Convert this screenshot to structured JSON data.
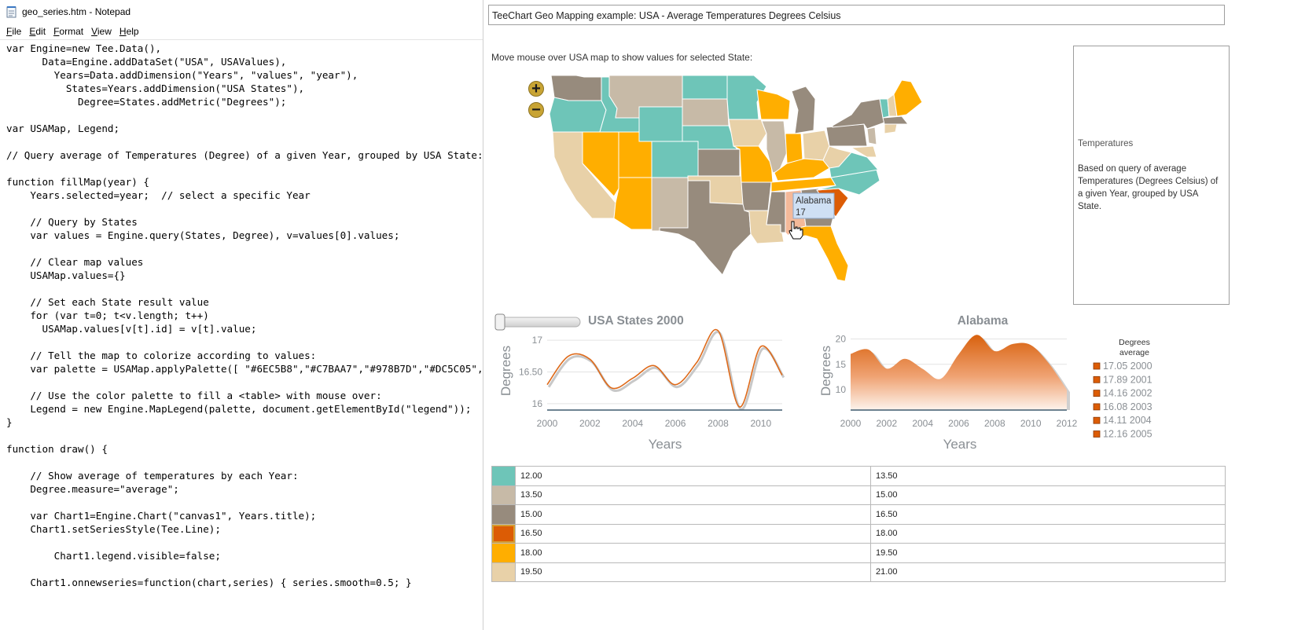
{
  "notepad": {
    "title": "geo_series.htm - Notepad",
    "menu": [
      "File",
      "Edit",
      "Format",
      "View",
      "Help"
    ],
    "code": "var Engine=new Tee.Data(),\n      Data=Engine.addDataSet(\"USA\", USAValues),\n        Years=Data.addDimension(\"Years\", \"values\", \"year\"),\n          States=Years.addDimension(\"USA States\"),\n            Degree=States.addMetric(\"Degrees\");\n\nvar USAMap, Legend;\n\n// Query average of Temperatures (Degree) of a given Year, grouped by USA State:\n\nfunction fillMap(year) {\n    Years.selected=year;  // select a specific Year\n\n    // Query by States\n    var values = Engine.query(States, Degree), v=values[0].values;\n\n    // Clear map values\n    USAMap.values={}\n\n    // Set each State result value\n    for (var t=0; t<v.length; t++)\n      USAMap.values[v[t].id] = v[t].value;\n\n    // Tell the map to colorize according to values:\n    var palette = USAMap.applyPalette([ \"#6EC5B8\",\"#C7BAA7\",\"#978B7D\",\"#DC5C05\",\"\n\n    // Use the color palette to fill a <table> with mouse over:\n    Legend = new Engine.MapLegend(palette, document.getElementById(\"legend\"));\n}\n\nfunction draw() {\n\n    // Show average of temperatures by each Year:\n    Degree.measure=\"average\";\n\n    var Chart1=Engine.Chart(\"canvas1\", Years.title);\n    Chart1.setSeriesStyle(Tee.Line);\n\n        Chart1.legend.visible=false;\n\n    Chart1.onnewseries=function(chart,series) { series.smooth=0.5; }"
  },
  "page": {
    "title": "TeeChart Geo Mapping example: USA - Average Temperatures Degrees Celsius",
    "instructions": "Move mouse over USA map to show values for selected State:",
    "zoom_in": "+",
    "zoom_out": "−",
    "tooltip": {
      "state": "Alabama",
      "value": "17"
    },
    "legend_panel": {
      "title": "Temperatures",
      "description": "Based on query of average Temperatures (Degrees Celsius) of a given Year, grouped by USA State."
    },
    "palette": [
      "#6EC5B8",
      "#C7BAA7",
      "#978B7D",
      "#DC5C05",
      "#FFAE00",
      "#E8D1A8"
    ],
    "icons": {
      "zoom_in": "plus-icon",
      "zoom_out": "minus-icon",
      "cursor": "hand-cursor-icon",
      "file": "notepad-icon"
    }
  },
  "value_table": [
    {
      "color": "#6EC5B8",
      "from": "12.00",
      "to": "13.50",
      "selected": false
    },
    {
      "color": "#C7BAA7",
      "from": "13.50",
      "to": "15.00",
      "selected": false
    },
    {
      "color": "#978B7D",
      "from": "15.00",
      "to": "16.50",
      "selected": false
    },
    {
      "color": "#DC5C05",
      "from": "16.50",
      "to": "18.00",
      "selected": true
    },
    {
      "color": "#FFAE00",
      "from": "18.00",
      "to": "19.50",
      "selected": false
    },
    {
      "color": "#E8D1A8",
      "from": "19.50",
      "to": "21.00",
      "selected": false
    }
  ],
  "chart_data": [
    {
      "type": "line",
      "title": "USA States 2000",
      "xlabel": "Years",
      "ylabel": "Degrees",
      "x": [
        2000,
        2001,
        2002,
        2003,
        2004,
        2005,
        2006,
        2007,
        2008,
        2009,
        2010,
        2011
      ],
      "series": [
        {
          "values": [
            16.3,
            16.75,
            16.7,
            16.25,
            16.4,
            16.6,
            16.3,
            16.65,
            17.15,
            15.95,
            16.9,
            16.45
          ]
        }
      ],
      "xlim": [
        2000,
        2011
      ],
      "ylim": [
        15.9,
        17.1
      ],
      "xticks": [
        "2000",
        "2002",
        "2004",
        "2006",
        "2008",
        "2010",
        "201"
      ],
      "yticks": [
        "16",
        "16.50",
        "17"
      ],
      "slider": 2000
    },
    {
      "type": "area",
      "title": "Alabama",
      "xlabel": "Years",
      "ylabel": "Degrees",
      "x": [
        2000,
        2001,
        2002,
        2003,
        2004,
        2005,
        2006,
        2007,
        2008,
        2009,
        2010,
        2011,
        2012
      ],
      "series": [
        {
          "values": [
            17.05,
            17.89,
            14.16,
            16.08,
            14.11,
            12.16,
            17.0,
            20.8,
            17.6,
            19.0,
            18.8,
            15.2,
            10.0
          ]
        }
      ],
      "xlim": [
        2000,
        2012
      ],
      "ylim": [
        6,
        21
      ],
      "xticks": [
        "2000",
        "2002",
        "2004",
        "2006",
        "2008",
        "2010",
        "2012"
      ],
      "yticks": [
        "10",
        "15",
        "20"
      ],
      "legend": {
        "title_line1": "Degrees",
        "title_line2": "average",
        "entries": [
          "17.05 2000",
          "17.89 2001",
          "14.16 2002",
          "16.08 2003",
          "14.11 2004",
          "12.16 2005"
        ]
      }
    }
  ]
}
